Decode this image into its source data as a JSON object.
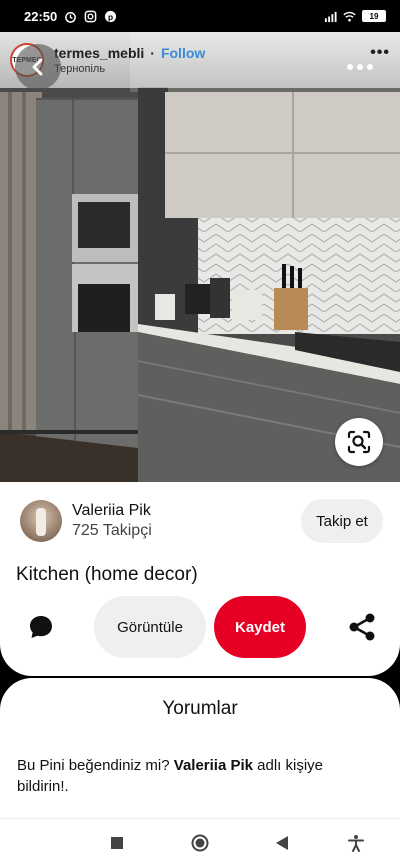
{
  "status_bar": {
    "time": "22:50",
    "battery": "19"
  },
  "instagram_overlay": {
    "logo_text": "TEPMEC",
    "username": "termes_mebli",
    "separator": "·",
    "follow": "Follow",
    "location": "Тернопіль",
    "more": "•••"
  },
  "creator": {
    "name": "Valeriia Pik",
    "followers": "725 Takipçi",
    "follow_button": "Takip et"
  },
  "pin": {
    "title": "Kitchen (home decor)"
  },
  "actions": {
    "view_button": "Görüntüle",
    "save_button": "Kaydet"
  },
  "comments": {
    "title": "Yorumlar",
    "prompt_before": "Bu Pini beğendiniz mi? ",
    "prompt_name": "Valeriia Pik",
    "prompt_after": " adlı kişiye bildirin!."
  },
  "colors": {
    "save_red": "#e60023",
    "follow_blue": "#3a8ad6"
  }
}
